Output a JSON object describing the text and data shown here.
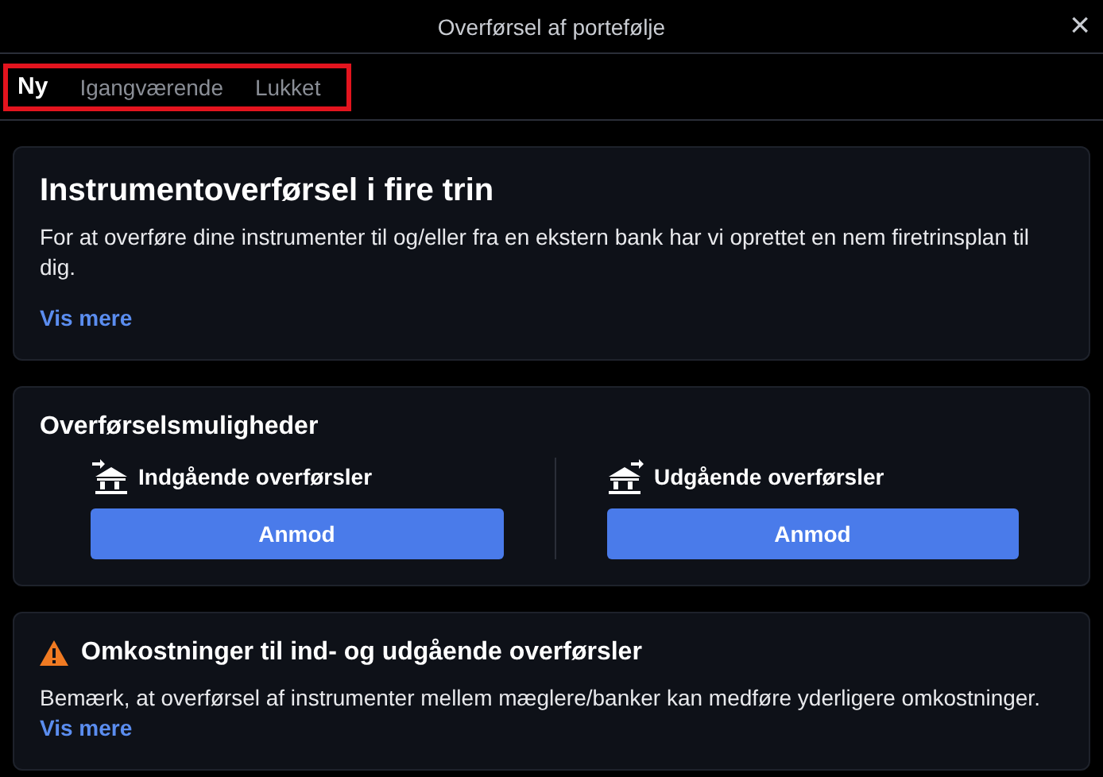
{
  "window": {
    "title": "Overførsel af portefølje",
    "close": "×"
  },
  "tabs": [
    {
      "label": "Ny",
      "selected": true
    },
    {
      "label": "Igangværende",
      "selected": false
    },
    {
      "label": "Lukket",
      "selected": false
    }
  ],
  "intro": {
    "heading": "Instrumentoverførsel i fire trin",
    "text": "For at overføre dine instrumenter til og/eller fra en ekstern bank har vi oprettet en nem firetrinsplan til dig.",
    "link": "Vis mere"
  },
  "options": {
    "heading": "Overførselsmuligheder",
    "items": [
      {
        "kind": "incoming",
        "label": "Indgående overførsler",
        "button": "Anmod"
      },
      {
        "kind": "outgoing",
        "label": "Udgående overførsler",
        "button": "Anmod"
      }
    ]
  },
  "notice": {
    "heading": "Omkostninger til ind- og udgående overførsler",
    "text": "Bemærk, at overførsel af instrumenter mellem mæglere/banker kan medføre yderligere omkostninger.",
    "link": "Vis mere"
  }
}
